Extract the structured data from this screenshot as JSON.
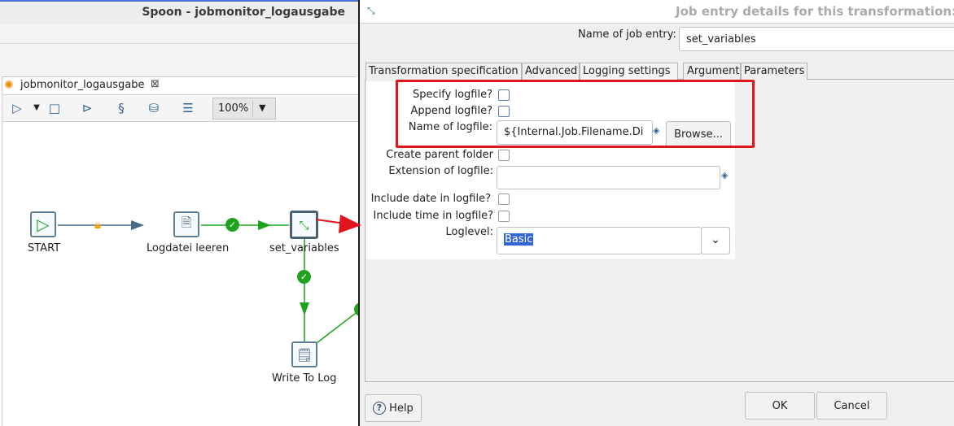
{
  "spoon": {
    "window_title": "Spoon - jobmonitor_logausgabe",
    "tab_label": "jobmonitor_logausgabe",
    "zoom": "100%",
    "nodes": {
      "start": "START",
      "logdatei": "Logdatei leeren",
      "set_variables": "set_variables",
      "write_to_log": "Write To Log"
    }
  },
  "dialog": {
    "title": "Job entry details for this transformation:",
    "name_label": "Name of job entry:",
    "name_value": "set_variables",
    "tabs": [
      "Transformation specification",
      "Advanced",
      "Logging settings",
      "Argument",
      "Parameters"
    ],
    "active_tab": "Logging settings",
    "fields": {
      "specify_logfile": "Specify logfile?",
      "append_logfile": "Append logfile?",
      "name_of_logfile": "Name of logfile:",
      "logfile_value": "${Internal.Job.Filename.Di",
      "browse": "Browse...",
      "create_parent_folder": "Create parent folder",
      "extension_of_logfile": "Extension of logfile:",
      "extension_value": "",
      "include_date": "Include date in logfile?",
      "include_time": "Include time in logfile?",
      "loglevel_label": "Loglevel:",
      "loglevel_value": "Basic"
    },
    "buttons": {
      "help": "Help",
      "ok": "OK",
      "cancel": "Cancel"
    }
  },
  "colors": {
    "highlight": "#e0141b",
    "selection": "#3465d5",
    "success": "#1fa31f",
    "lock": "#f0a000"
  }
}
